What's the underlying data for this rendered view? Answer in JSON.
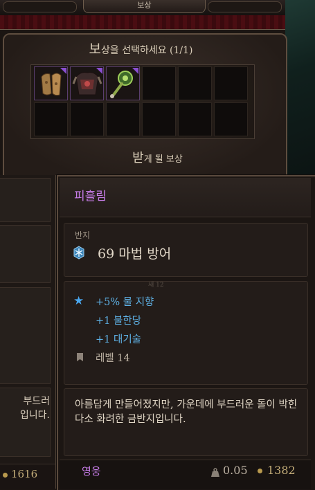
{
  "window": {
    "title": "보상"
  },
  "reward": {
    "title_cap": "보",
    "title_rest": "상을 선택하세요 (1/1)",
    "receive_cap": "받",
    "receive_rest": "게 될 보상"
  },
  "slots": [
    {
      "item": "leather-gloves-icon",
      "rarity_color": "#8a4fd0"
    },
    {
      "item": "dark-armor-icon",
      "rarity_color": "#8a4fd0"
    },
    {
      "item": "green-ring-icon",
      "rarity_color": "#8a4fd0"
    }
  ],
  "left_panel": {
    "desc_line1": "부드러",
    "desc_line2": "입니다.",
    "price": "1616"
  },
  "tooltip": {
    "name": "피흘림",
    "type": "반지",
    "stat": "69 마법 방어",
    "faint": "새 12",
    "bonuses": [
      "+5% 물 지향",
      "+1 불한당",
      "+1 대기술"
    ],
    "level": "레벨 14",
    "description": "아름답게 만들어졌지만, 가운데에 부드러운 돌이 박힌 다소 화려한 금반지입니다.",
    "rarity": "영웅",
    "weight": "0.05",
    "price": "1382"
  },
  "colors": {
    "rarity_epic": "#c77de8",
    "bonus_blue": "#5fb3e8",
    "gold": "#c7b07b"
  }
}
